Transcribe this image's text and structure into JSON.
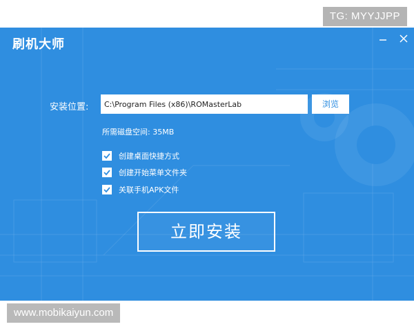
{
  "watermarks": {
    "top": "TG: MYYJJPP",
    "bottom": "www.mobikaiyun.com"
  },
  "window": {
    "title": "刷机大师",
    "minimize_icon": "minimize-icon",
    "close_icon": "close-icon"
  },
  "install": {
    "location_label": "安装位置:",
    "path_value": "C:\\Program Files (x86)\\ROMasterLab",
    "browse_label": "浏览",
    "space_required": "所需磁盘空间: 35MB",
    "options": [
      {
        "label": "创建桌面快捷方式",
        "checked": true
      },
      {
        "label": "创建开始菜单文件夹",
        "checked": true
      },
      {
        "label": "关联手机APK文件",
        "checked": true
      }
    ],
    "install_button": "立即安装"
  },
  "colors": {
    "window_bg": "#2f8ee0",
    "text": "#ffffff",
    "watermark_bg": "#b4b4b4"
  }
}
